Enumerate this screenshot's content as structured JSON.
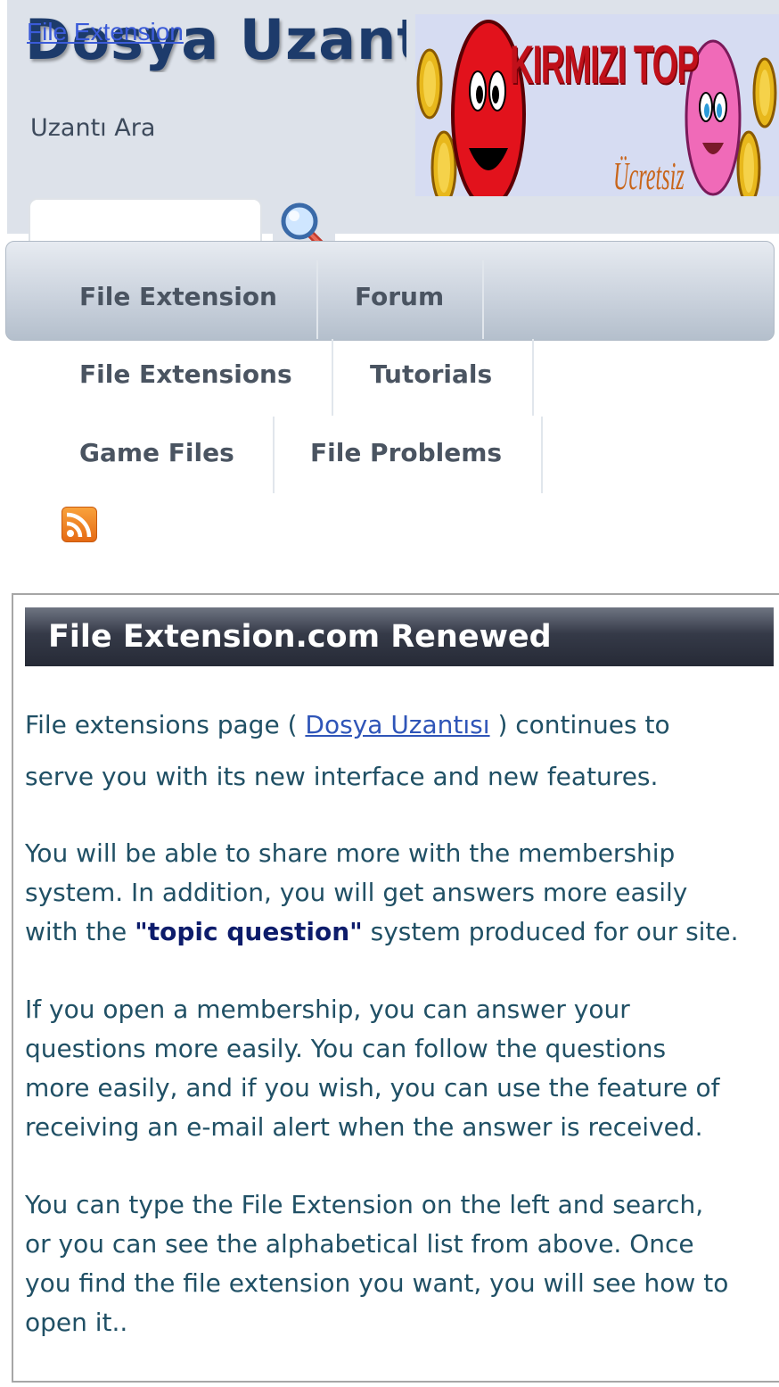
{
  "header": {
    "logo_text": "Dosya Uzantısı",
    "logo_link_text": "File Extension",
    "sub_label": "Uzantı Ara",
    "search": {
      "value": "",
      "placeholder": ""
    }
  },
  "banner": {
    "title": "KIRMIZI TOP",
    "subtitle": "Ücretsiz"
  },
  "nav": {
    "items": [
      "File Extension",
      "Forum",
      "File Extensions",
      "Tutorials",
      "Game Files",
      "File Problems"
    ]
  },
  "article": {
    "title": "File Extension.com Renewed",
    "p1_before": "File extensions page ( ",
    "p1_link": "Dosya Uzantısı",
    "p1_after": " ) continues to",
    "p1_line2": "serve you with its new interface and new features.",
    "p2_line1": "You will be able to share more with the membership",
    "p2_line2": "system. In addition, you will get answers more easily",
    "p2_line3_before": "with the ",
    "p2_line3_strong": "\"topic question\"",
    "p2_line3_after": " system produced for our site.",
    "p3_line1": "If you open a membership, you can answer your",
    "p3_line2": "questions more easily. You can follow the questions",
    "p3_line3": "more easily, and if you wish, you can use the feature of",
    "p3_line4": "receiving an e-mail alert when the answer is received.",
    "p4_line1": "You can type the File Extension on the left and search,",
    "p4_line2": "or you can see the alphabetical list from above. Once",
    "p4_line3": "you find the file extension you want, you will see how to",
    "p4_line4": "open it.."
  }
}
